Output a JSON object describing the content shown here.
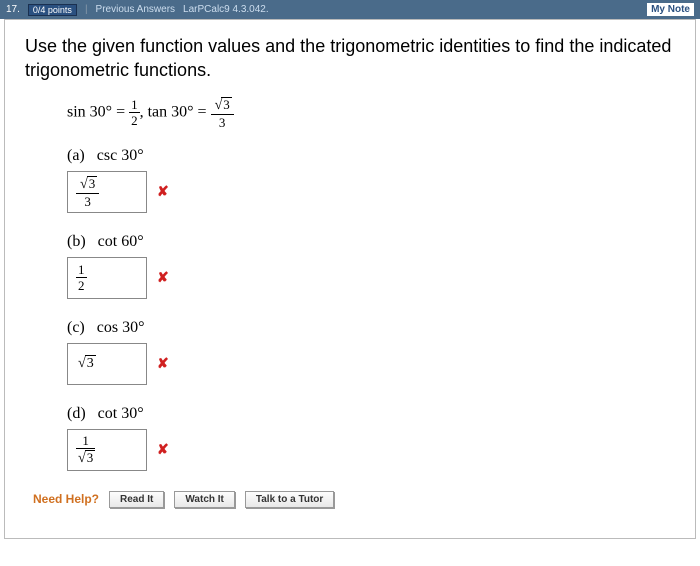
{
  "header": {
    "qnum": "17.",
    "points": "0/4 points",
    "prev": "Previous Answers",
    "ref": "LarPCalc9 4.3.042.",
    "mynote": "My Note"
  },
  "prompt": "Use the given function values and the trigonometric identities to find the indicated trigonometric functions.",
  "given": {
    "sin_label": "sin 30° = ",
    "sin_num": "1",
    "sin_den": "2",
    "sep": ",   ",
    "tan_label": "tan 30° = ",
    "tan_num": "3",
    "tan_den": "3"
  },
  "parts": {
    "a": {
      "label": "(a)",
      "fn": "csc 30°",
      "ans_num": "3",
      "ans_den": "3",
      "wrong": "✘"
    },
    "b": {
      "label": "(b)",
      "fn": "cot 60°",
      "ans_num": "1",
      "ans_den": "2",
      "wrong": "✘"
    },
    "c": {
      "label": "(c)",
      "fn": "cos 30°",
      "ans": "3",
      "wrong": "✘"
    },
    "d": {
      "label": "(d)",
      "fn": "cot 30°",
      "ans_num": "1",
      "ans_den": "3",
      "wrong": "✘"
    }
  },
  "help": {
    "label": "Need Help?",
    "read": "Read It",
    "watch": "Watch It",
    "tutor": "Talk to a Tutor"
  }
}
